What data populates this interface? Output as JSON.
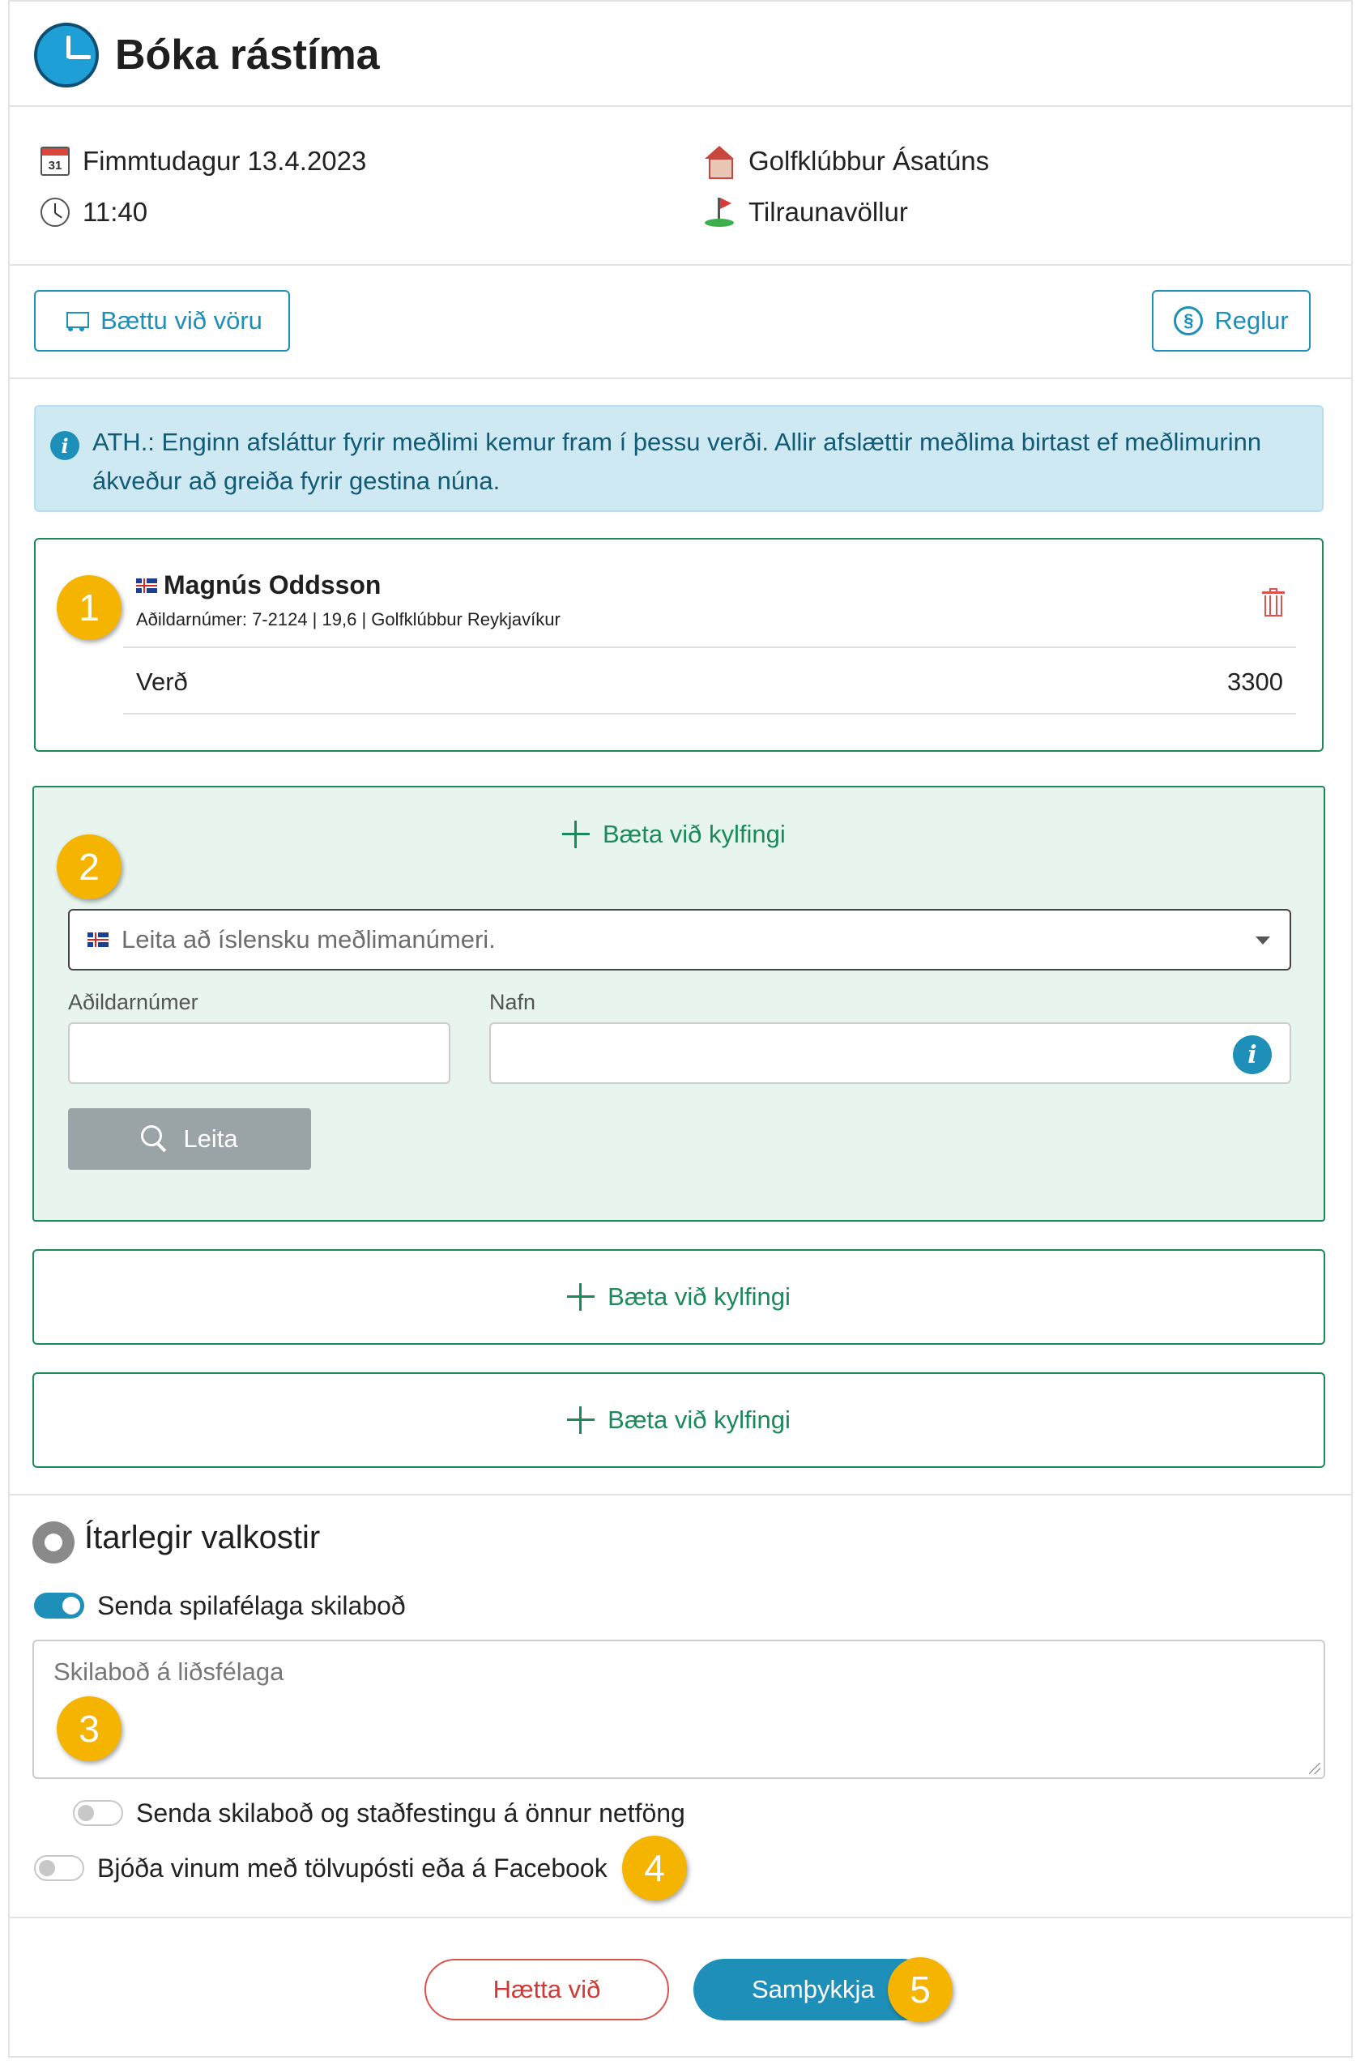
{
  "header": {
    "title": "Bóka rástíma"
  },
  "info": {
    "date": "Fimmtudagur 13.4.2023",
    "calendar_day": "31",
    "time": "11:40",
    "club": "Golfklúbbur Ásatúns",
    "course": "Tilraunavöllur"
  },
  "toolbar": {
    "add_product_label": "Bættu við vöru",
    "rules_label": "Reglur",
    "rules_symbol": "§"
  },
  "alert": {
    "icon_glyph": "i",
    "message": "ATH.: Enginn afsláttur fyrir meðlimi kemur fram í þessu verði. Allir afslættir meðlima birtast ef meðlimurinn ákveður að greiða fyrir gestina núna."
  },
  "player": {
    "name": "Magnús Oddsson",
    "meta": "Aðildarnúmer: 7-2124 | 19,6 | Golfklúbbur Reykjavíkur",
    "price_label": "Verð",
    "price_value": "3300"
  },
  "add_golfer": {
    "label": "Bæta við kylfingi",
    "search_placeholder": "Leita að íslensku meðlimanúmeri.",
    "member_no_label": "Aðildarnúmer",
    "name_label": "Nafn",
    "info_glyph": "i",
    "search_button": "Leita"
  },
  "advanced": {
    "title": "Ítarlegir valkostir",
    "send_message_toggle": {
      "label": "Senda spilafélaga skilaboð",
      "on": true
    },
    "message_placeholder": "Skilaboð á liðsfélaga",
    "send_other_emails_toggle": {
      "label": "Senda skilaboð og staðfestingu á önnur netföng",
      "on": false
    },
    "invite_friends_toggle": {
      "label": "Bjóða vinum með tölvupósti eða á Facebook",
      "on": false
    }
  },
  "footer": {
    "cancel_label": "Hætta við",
    "confirm_label": "Samþykkja"
  },
  "callouts": [
    "1",
    "2",
    "3",
    "4",
    "5"
  ],
  "colors": {
    "accent": "#1e8fb8",
    "green": "#1a8a5a",
    "callout": "#f4b400",
    "danger": "#d9534f",
    "alert_bg": "#cfe9f3"
  },
  "icons": [
    "clock-icon",
    "calendar-icon",
    "house-icon",
    "golf-flag-icon",
    "cart-icon",
    "paragraph-icon",
    "info-icon",
    "iceland-flag-icon",
    "trash-icon",
    "plus-icon",
    "caret-down-icon",
    "search-icon",
    "gear-icon"
  ]
}
